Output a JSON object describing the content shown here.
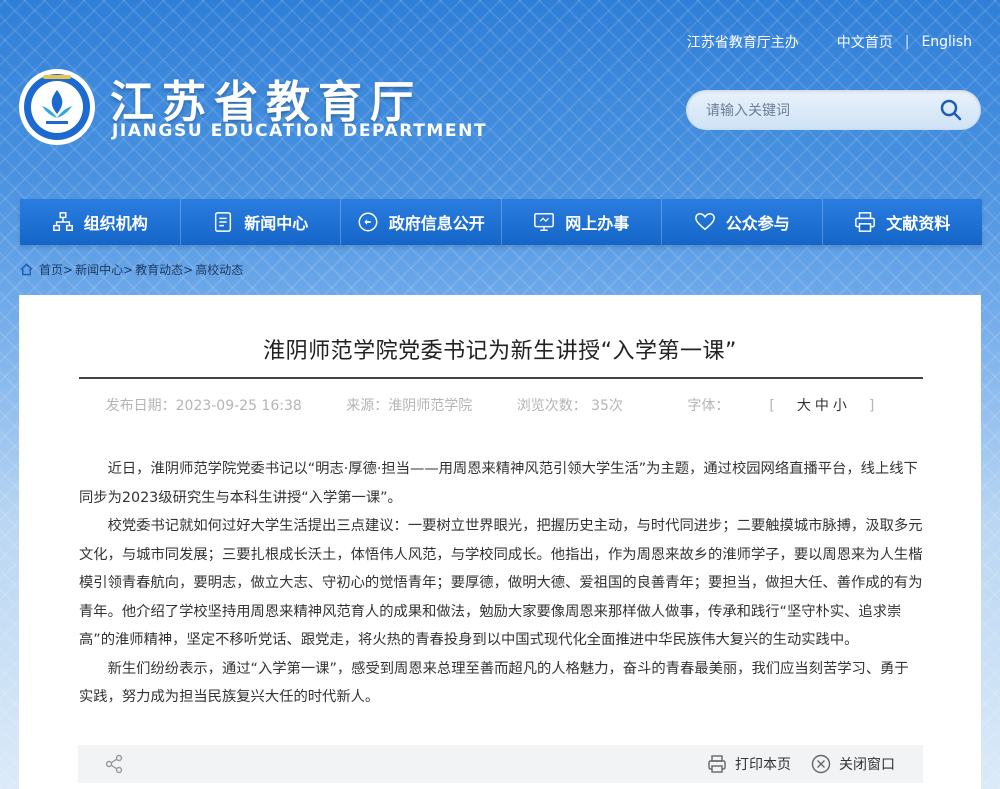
{
  "header": {
    "host_link": "江苏省教育厅主办",
    "home_cn": "中文首页",
    "divider": "|",
    "english": "English",
    "title_cn": "江苏省教育厅",
    "title_en": "JIANGSU EDUCATION DEPARTMENT",
    "search_placeholder": "请输入关键词"
  },
  "nav": [
    {
      "label": "组织机构",
      "icon": "org-chart-icon"
    },
    {
      "label": "新闻中心",
      "icon": "document-icon"
    },
    {
      "label": "政府信息公开",
      "icon": "chat-icon"
    },
    {
      "label": "网上办事",
      "icon": "monitor-icon"
    },
    {
      "label": "公众参与",
      "icon": "heart-icon"
    },
    {
      "label": "文献资料",
      "icon": "printer-icon"
    }
  ],
  "breadcrumb": [
    "首页>",
    "新闻中心>",
    "教育动态>",
    "高校动态"
  ],
  "article": {
    "title": "淮阴师范学院党委书记为新生讲授“入学第一课”",
    "date": "发布日期：2023-09-25 16:38",
    "source": "来源：淮阴师范学院",
    "views": "浏览次数：  35次",
    "font_label": "字体：",
    "font_open": "[",
    "font_large": "大",
    "font_medium": "中",
    "font_small": "小",
    "font_close": "]",
    "paragraphs": [
      "近日，淮阴师范学院党委书记以“明志·厚德·担当——用周恩来精神风范引领大学生活”为主题，通过校园网络直播平台，线上线下同步为2023级研究生与本科生讲授“入学第一课”。",
      "校党委书记就如何过好大学生活提出三点建议：一要树立世界眼光，把握历史主动，与时代同进步；二要触摸城市脉搏，汲取多元文化，与城市同发展；三要扎根成长沃土，体悟伟人风范，与学校同成长。他指出，作为周恩来故乡的淮师学子，要以周恩来为人生楷模引领青春航向，要明志，做立大志、守初心的觉悟青年；要厚德，做明大德、爱祖国的良善青年；要担当，做担大任、善作成的有为青年。他介绍了学校坚持用周恩来精神风范育人的成果和做法，勉励大家要像周恩来那样做人做事，传承和践行“坚守朴实、追求崇高”的淮师精神，坚定不移听党话、跟党走，将火热的青春投身到以中国式现代化全面推进中华民族伟大复兴的生动实践中。",
      "新生们纷纷表示，通过“入学第一课”，感受到周恩来总理至善而超凡的人格魅力，奋斗的青春最美丽，我们应当刻苦学习、勇于实践，努力成为担当民族复兴大任的时代新人。"
    ]
  },
  "footer": {
    "print_label": "打印本页",
    "close_label": "关闭窗口"
  },
  "colors": {
    "nav_blue": "#1a6fd4",
    "accent_white": "#ffffff",
    "text_dark": "#333333"
  }
}
